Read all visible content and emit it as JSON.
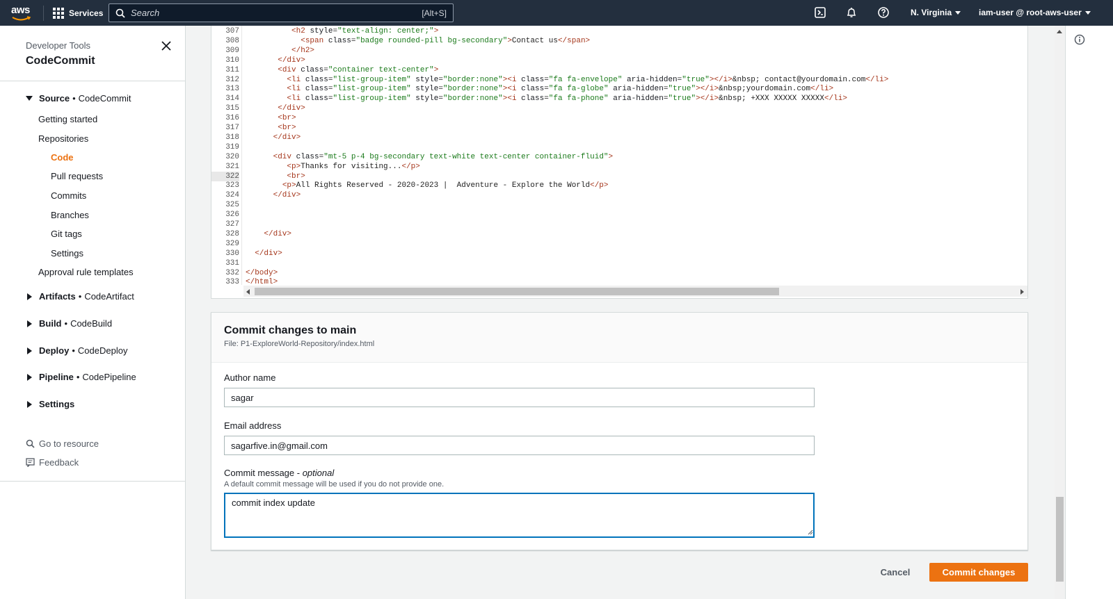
{
  "topnav": {
    "logo": "aws",
    "services_label": "Services",
    "search_placeholder": "Search",
    "search_shortcut": "[Alt+S]",
    "region": "N. Virginia",
    "user": "iam-user @ root-aws-user",
    "icons": [
      "cloudshell-icon",
      "bell-icon",
      "help-icon"
    ]
  },
  "sidebar": {
    "category": "Developer Tools",
    "service": "CodeCommit",
    "source_section": {
      "name": "Source",
      "service": "CodeCommit"
    },
    "items": {
      "getting_started": "Getting started",
      "repositories": "Repositories",
      "code": "Code",
      "pull_requests": "Pull requests",
      "commits": "Commits",
      "branches": "Branches",
      "git_tags": "Git tags",
      "settings": "Settings",
      "approval_rules": "Approval rule templates"
    },
    "sections": [
      {
        "name": "Artifacts",
        "service": "CodeArtifact"
      },
      {
        "name": "Build",
        "service": "CodeBuild"
      },
      {
        "name": "Deploy",
        "service": "CodeDeploy"
      },
      {
        "name": "Pipeline",
        "service": "CodePipeline"
      },
      {
        "name": "Settings",
        "service": ""
      }
    ],
    "go_to_resource": "Go to resource",
    "feedback": "Feedback",
    "active_color": "#ec7211"
  },
  "editor": {
    "current_line": "322",
    "lines": [
      {
        "n": "307",
        "code": "          <h2 style=\"text-align: center;\">"
      },
      {
        "n": "308",
        "code": "            <span class=\"badge rounded-pill bg-secondary\">Contact us</span>"
      },
      {
        "n": "309",
        "code": "          </h2>"
      },
      {
        "n": "310",
        "code": "       </div>"
      },
      {
        "n": "311",
        "code": "       <div class=\"container text-center\">"
      },
      {
        "n": "312",
        "code": "         <li class=\"list-group-item\" style=\"border:none\"><i class=\"fa fa-envelope\" aria-hidden=\"true\"></i>&nbsp; contact@yourdomain.com</li>"
      },
      {
        "n": "313",
        "code": "         <li class=\"list-group-item\" style=\"border:none\"><i class=\"fa fa-globe\" aria-hidden=\"true\"></i>&nbsp;yourdomain.com</li>"
      },
      {
        "n": "314",
        "code": "         <li class=\"list-group-item\" style=\"border:none\"><i class=\"fa fa-phone\" aria-hidden=\"true\"></i>&nbsp; +XXX XXXXX XXXXX</li>"
      },
      {
        "n": "315",
        "code": "       </div>"
      },
      {
        "n": "316",
        "code": "       <br>"
      },
      {
        "n": "317",
        "code": "       <br>"
      },
      {
        "n": "318",
        "code": "      </div>"
      },
      {
        "n": "319",
        "code": ""
      },
      {
        "n": "320",
        "code": "      <div class=\"mt-5 p-4 bg-secondary text-white text-center container-fluid\">"
      },
      {
        "n": "321",
        "code": "         <p>Thanks for visiting...</p>"
      },
      {
        "n": "322",
        "code": "         <br>"
      },
      {
        "n": "323",
        "code": "        <p>All Rights Reserved - 2020-2023 |  Adventure - Explore the World</p>"
      },
      {
        "n": "324",
        "code": "      </div>"
      },
      {
        "n": "325",
        "code": ""
      },
      {
        "n": "326",
        "code": ""
      },
      {
        "n": "327",
        "code": ""
      },
      {
        "n": "328",
        "code": "    </div>"
      },
      {
        "n": "329",
        "code": ""
      },
      {
        "n": "330",
        "code": "  </div>"
      },
      {
        "n": "331",
        "code": ""
      },
      {
        "n": "332",
        "code": "</body>"
      },
      {
        "n": "333",
        "code": "</html>"
      }
    ]
  },
  "commit": {
    "title": "Commit changes to main",
    "file": "File: P1-ExploreWorld-Repository/index.html",
    "author_label": "Author name",
    "author_value": "sagar",
    "email_label": "Email address",
    "email_value": "sagarfive.in@gmail.com",
    "message_label": "Commit message",
    "message_optional": "optional",
    "message_desc": "A default commit message will be used if you do not provide one.",
    "message_value": "commit index update",
    "cancel_label": "Cancel",
    "commit_label": "Commit changes",
    "primary_color": "#ec7211"
  }
}
